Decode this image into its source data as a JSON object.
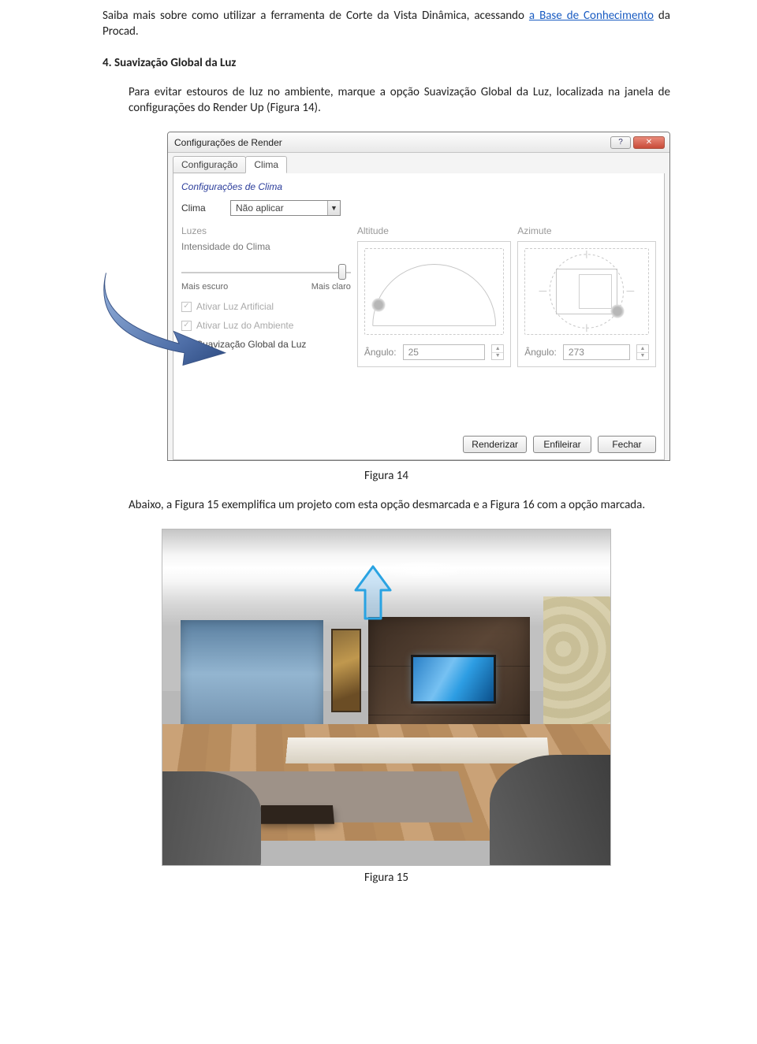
{
  "intro": {
    "text_before_link": "Saiba mais sobre como utilizar a ferramenta de Corte da Vista Dinâmica, acessando ",
    "link_text": "a Base de Conhecimento",
    "text_after_link": " da Procad."
  },
  "section4": {
    "heading": "4. Suavização Global da Luz",
    "para": "Para evitar estouros de luz no ambiente, marque a opção Suavização Global da Luz, localizada na janela de configurações do Render Up (Figura 14)."
  },
  "dialog": {
    "title": "Configurações de Render",
    "tabs": {
      "config": "Configuração",
      "clima": "Clima"
    },
    "group_title": "Configurações de Clima",
    "clima_label": "Clima",
    "clima_value": "Não aplicar",
    "panel_luzes": "Luzes",
    "intensidade": "Intensidade do Clima",
    "slider_min": "Mais escuro",
    "slider_max": "Mais claro",
    "chk_artificial": "Ativar Luz Artificial",
    "chk_ambiente": "Ativar Luz do Ambiente",
    "chk_global": "Suavização Global da Luz",
    "panel_altitude": "Altitude",
    "panel_azimute": "Azimute",
    "angle_label": "Ângulo:",
    "angle_alt": "25",
    "angle_azi": "273",
    "btn_render": "Renderizar",
    "btn_enfileirar": "Enfileirar",
    "btn_fechar": "Fechar"
  },
  "caption14": "Figura 14",
  "para_between": "Abaixo, a Figura 15 exemplifica um projeto com esta opção desmarcada e a Figura 16 com a opção marcada.",
  "caption15": "Figura 15"
}
